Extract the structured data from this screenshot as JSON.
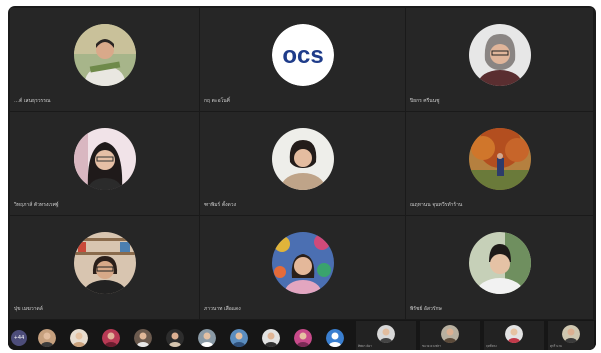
{
  "participants": [
    {
      "name": "…ต์ เสนธุรวรรณ",
      "avatar": "woman-garden"
    },
    {
      "name": "กฤ ตะอโนศิ์",
      "avatar": "ocs-logo",
      "logo_text": "ocs"
    },
    {
      "name": "ปิยกร ศรีนนชู",
      "avatar": "woman-glasses-gray"
    },
    {
      "name": "วิหฤภาส์ ตัวทรงเรศฐ์",
      "avatar": "woman-glasses-pink"
    },
    {
      "name": "ฑาพิมร์ ตั้งดวง",
      "avatar": "woman-white-wall"
    },
    {
      "name": "ณฤหานน จุนทวีรทำร้าน",
      "avatar": "person-autumn-tree"
    },
    {
      "name": "ปุข เมฆวาดล์",
      "avatar": "woman-office-shelves"
    },
    {
      "name": "ภาวนาท เสือแดง",
      "avatar": "woman-colorful-wall"
    },
    {
      "name": "พิรัชย์ อัสวรักษ",
      "avatar": "man-balcony"
    }
  ],
  "strip": {
    "more_label": "+44",
    "small_tiles": [
      {
        "name": "ทิพยา ค์ยา"
      },
      {
        "name": "ชแวย ดวงฟรา"
      },
      {
        "name": "ฤทธิ์ทรง"
      },
      {
        "name": "ศุกรี นาม"
      }
    ]
  }
}
